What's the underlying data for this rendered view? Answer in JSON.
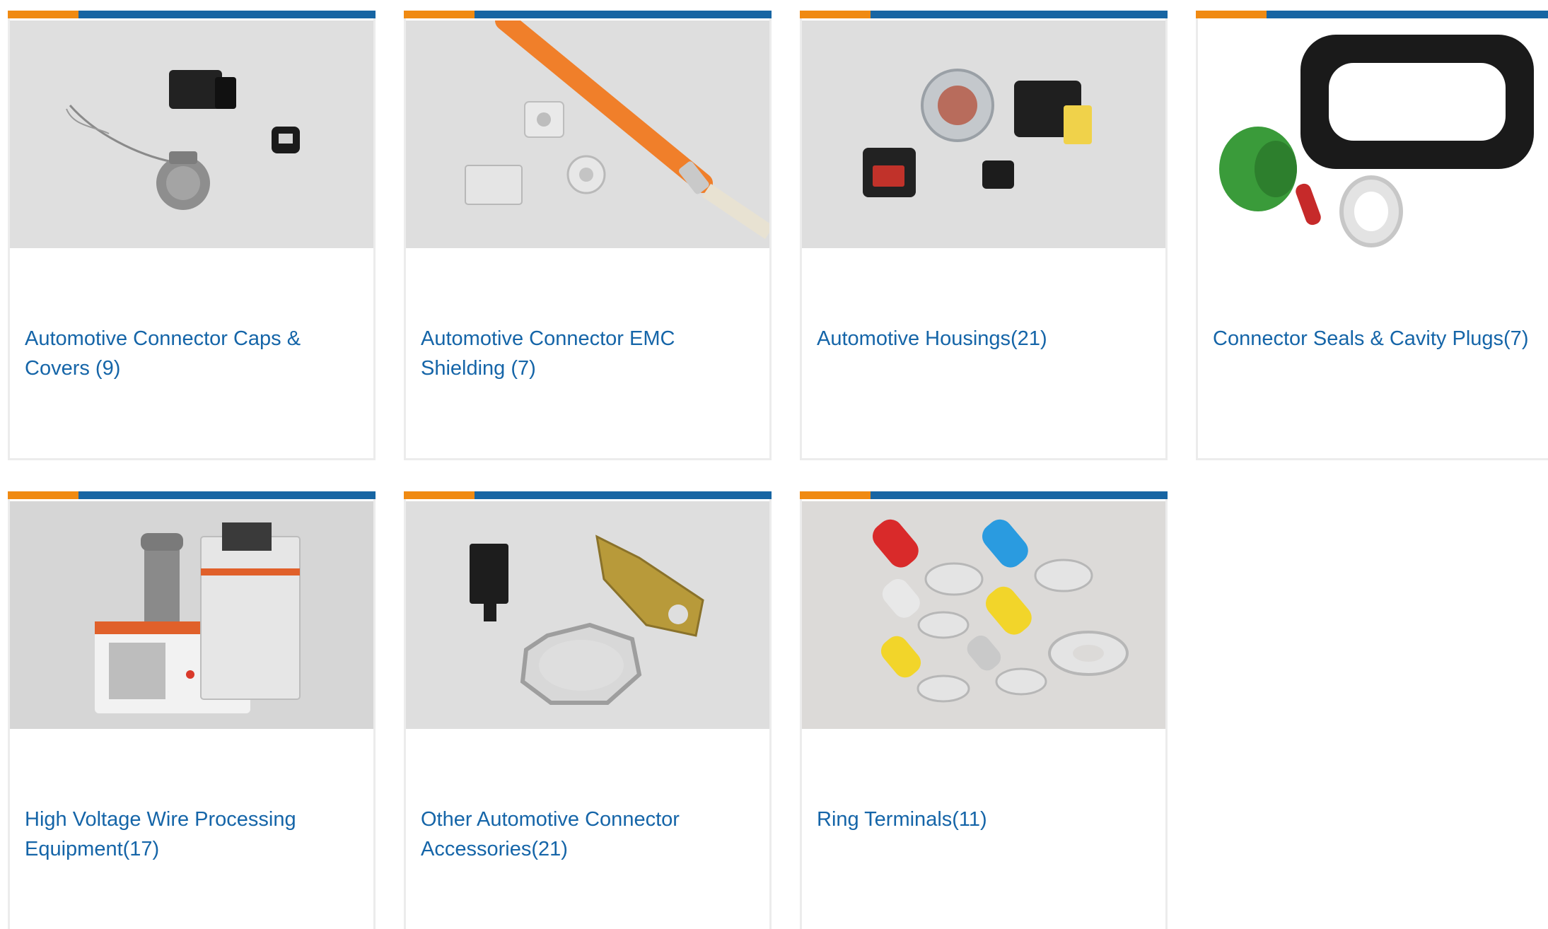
{
  "colors": {
    "accent_orange": "#f08a12",
    "accent_blue": "#1765a3",
    "link_blue": "#1565a8",
    "card_border": "#ececec"
  },
  "categories": [
    {
      "label": "Automotive Connector Caps & Covers (9)",
      "image": "caps-covers-image"
    },
    {
      "label": "Automotive Connector EMC Shielding (7)",
      "image": "emc-shielding-image"
    },
    {
      "label": "Automotive Housings(21)",
      "image": "housings-image"
    },
    {
      "label": "Connector Seals & Cavity Plugs(7)",
      "image": "seals-plugs-image"
    },
    {
      "label": "High Voltage Wire Processing Equipment(17)",
      "image": "wire-processing-image"
    },
    {
      "label": "Other Automotive Connector Accessories(21)",
      "image": "other-accessories-image"
    },
    {
      "label": "Ring Terminals(11)",
      "image": "ring-terminals-image"
    }
  ]
}
